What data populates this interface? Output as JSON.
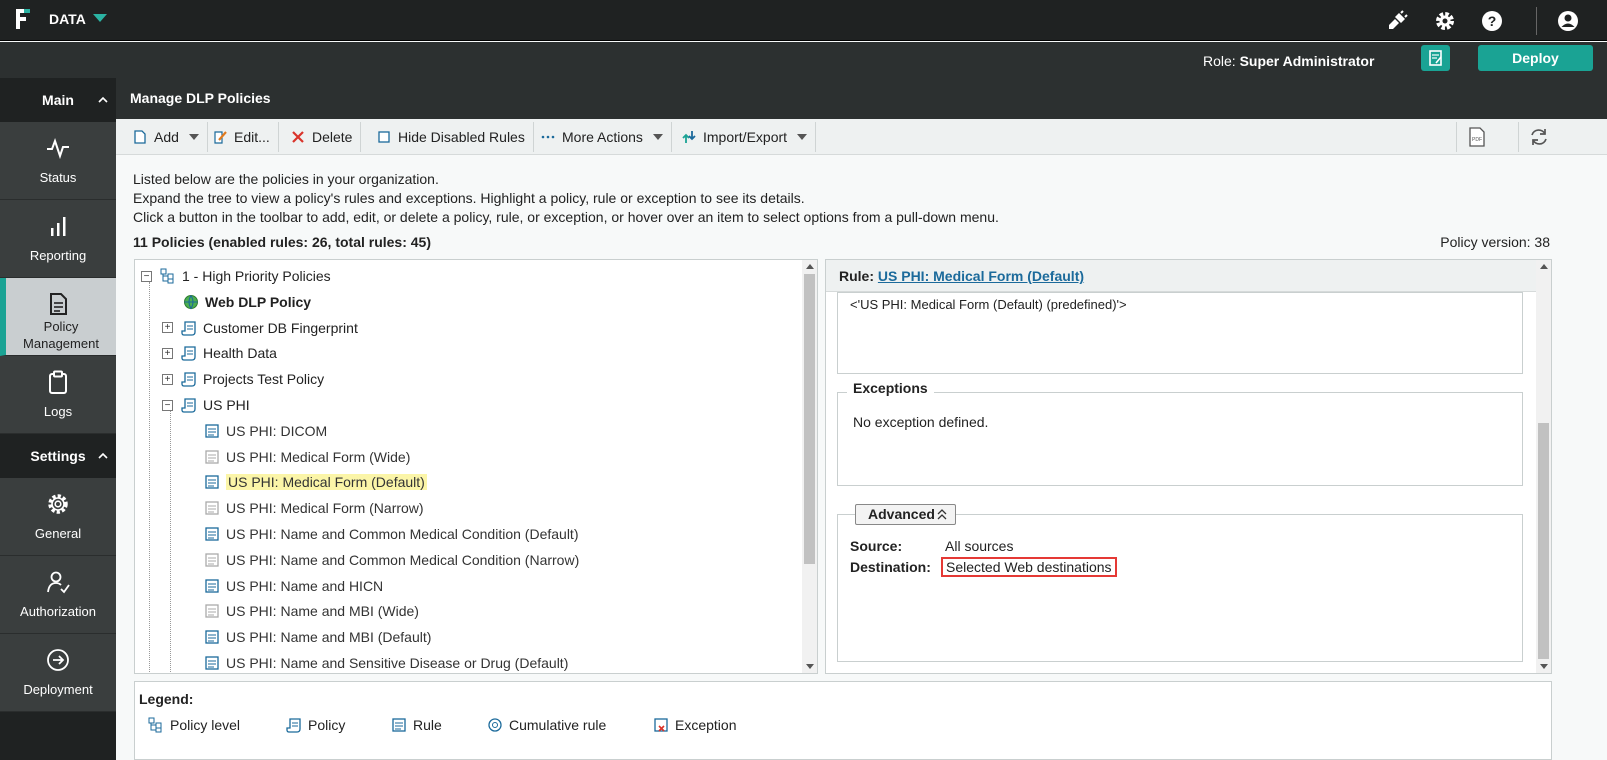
{
  "app": {
    "name": "DATA"
  },
  "role": {
    "label": "Role:",
    "value": "Super Administrator"
  },
  "deploy_label": "Deploy",
  "sidebar": {
    "main_heading": "Main",
    "settings_heading": "Settings",
    "main_items": [
      {
        "label": "Status",
        "icon": "pulse-icon"
      },
      {
        "label": "Reporting",
        "icon": "bar-chart-icon"
      },
      {
        "label": "Policy Management",
        "icon": "document-icon"
      },
      {
        "label": "Logs",
        "icon": "clipboard-icon"
      }
    ],
    "settings_items": [
      {
        "label": "General",
        "icon": "gear-icon"
      },
      {
        "label": "Authorization",
        "icon": "user-check-icon"
      },
      {
        "label": "Deployment",
        "icon": "arrow-circle-icon"
      }
    ]
  },
  "page_title": "Manage DLP Policies",
  "toolbar": {
    "add": "Add",
    "edit": "Edit...",
    "delete": "Delete",
    "hide_disabled": "Hide Disabled Rules",
    "more_actions": "More Actions",
    "import_export": "Import/Export"
  },
  "description": {
    "line1": "Listed below are the policies in your organization.",
    "line2": "Expand the tree to view a policy's rules and exceptions. Highlight a policy, rule or exception to see its details.",
    "line3": "Click a button in the toolbar to add, edit, or delete a policy, rule, or exception, or hover over an item to select options from a pull-down menu."
  },
  "summary": "11 Policies (enabled rules: 26, total rules: 45)",
  "policy_version": "Policy version: 38",
  "tree": [
    {
      "label": "1 - High Priority Policies",
      "toggle": "−",
      "icon": "policy-level"
    },
    {
      "label": "Web DLP Policy",
      "toggle": "",
      "icon": "web-policy",
      "bold": true
    },
    {
      "label": "Customer DB Fingerprint",
      "toggle": "+",
      "icon": "policy"
    },
    {
      "label": "Health Data",
      "toggle": "+",
      "icon": "policy"
    },
    {
      "label": "Projects Test Policy",
      "toggle": "+",
      "icon": "policy"
    },
    {
      "label": "US PHI",
      "toggle": "−",
      "icon": "policy"
    },
    {
      "label": "US PHI: DICOM",
      "icon": "rule"
    },
    {
      "label": "US PHI: Medical Form (Wide)",
      "icon": "rule-disabled"
    },
    {
      "label": "US PHI: Medical Form (Default)",
      "icon": "rule",
      "highlight": true
    },
    {
      "label": "US PHI: Medical Form (Narrow)",
      "icon": "rule-disabled"
    },
    {
      "label": "US PHI: Name and Common Medical Condition (Default)",
      "icon": "rule"
    },
    {
      "label": "US PHI: Name and Common Medical Condition (Narrow)",
      "icon": "rule-disabled"
    },
    {
      "label": "US PHI: Name and HICN",
      "icon": "rule"
    },
    {
      "label": "US PHI: Name and MBI (Wide)",
      "icon": "rule-disabled"
    },
    {
      "label": "US PHI: Name and MBI (Default)",
      "icon": "rule"
    },
    {
      "label": "US PHI: Name and Sensitive Disease or Drug (Default)",
      "icon": "rule"
    }
  ],
  "detail": {
    "rule_label": "Rule:",
    "rule_name": "US PHI: Medical Form (Default)",
    "rule_text": "<'US PHI: Medical Form (Default) (predefined)'>",
    "exceptions_title": "Exceptions",
    "exceptions_text": "No exception defined.",
    "advanced_label": "Advanced",
    "source_key": "Source:",
    "source_value": "All sources",
    "destination_key": "Destination:",
    "destination_value": "Selected Web destinations"
  },
  "legend": {
    "title": "Legend:",
    "items": [
      "Policy level",
      "Policy",
      "Rule",
      "Cumulative rule",
      "Exception"
    ]
  },
  "colors": {
    "accent": "#1aa394",
    "highlight": "#fbf5a8",
    "link": "#1b6a9b",
    "alert": "#e53935"
  }
}
